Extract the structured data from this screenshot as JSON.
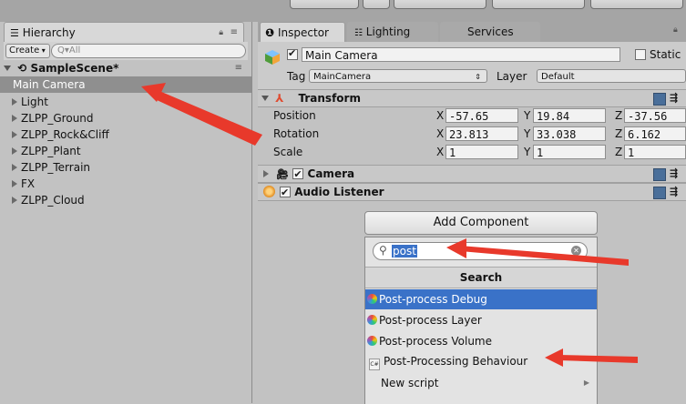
{
  "hierarchy": {
    "tab_label": "Hierarchy",
    "create_label": "Create",
    "search_placeholder": "Q▾All",
    "scene_name": "SampleScene*",
    "items": [
      {
        "label": "Main Camera"
      },
      {
        "label": "Light"
      },
      {
        "label": "ZLPP_Ground"
      },
      {
        "label": "ZLPP_Rock&Cliff"
      },
      {
        "label": "ZLPP_Plant"
      },
      {
        "label": "ZLPP_Terrain"
      },
      {
        "label": "FX"
      },
      {
        "label": "ZLPP_Cloud"
      }
    ]
  },
  "inspector": {
    "tabs": [
      "Inspector",
      "Lighting",
      "Services"
    ],
    "object_name": "Main Camera",
    "static_label": "Static",
    "tag_label": "Tag",
    "tag_value": "MainCamera",
    "layer_label": "Layer",
    "layer_value": "Default",
    "transform": {
      "title": "Transform",
      "position_label": "Position",
      "rotation_label": "Rotation",
      "scale_label": "Scale",
      "x": "X",
      "y": "Y",
      "z": "Z",
      "position": [
        "-57.65",
        "19.84",
        "-37.56"
      ],
      "rotation": [
        "23.813",
        "33.038",
        "6.162"
      ],
      "scale": [
        "1",
        "1",
        "1"
      ]
    },
    "components": [
      "Camera",
      "Audio Listener"
    ]
  },
  "add_component": {
    "button_label": "Add Component",
    "search_value": "post",
    "section_title": "Search",
    "results": [
      {
        "label": "Post-process Debug",
        "icon": "color-wheel-icon",
        "selected": true
      },
      {
        "label": "Post-process Layer",
        "icon": "color-wheel-icon",
        "selected": false
      },
      {
        "label": "Post-process Volume",
        "icon": "color-wheel-icon",
        "selected": false
      },
      {
        "label": "Post-Processing Behaviour",
        "icon": "csharp-script-icon",
        "selected": false
      },
      {
        "label": "New script",
        "icon": "",
        "selected": false
      }
    ]
  },
  "colors": {
    "selection": "#3a72c8",
    "arrow": "#e8392b"
  }
}
